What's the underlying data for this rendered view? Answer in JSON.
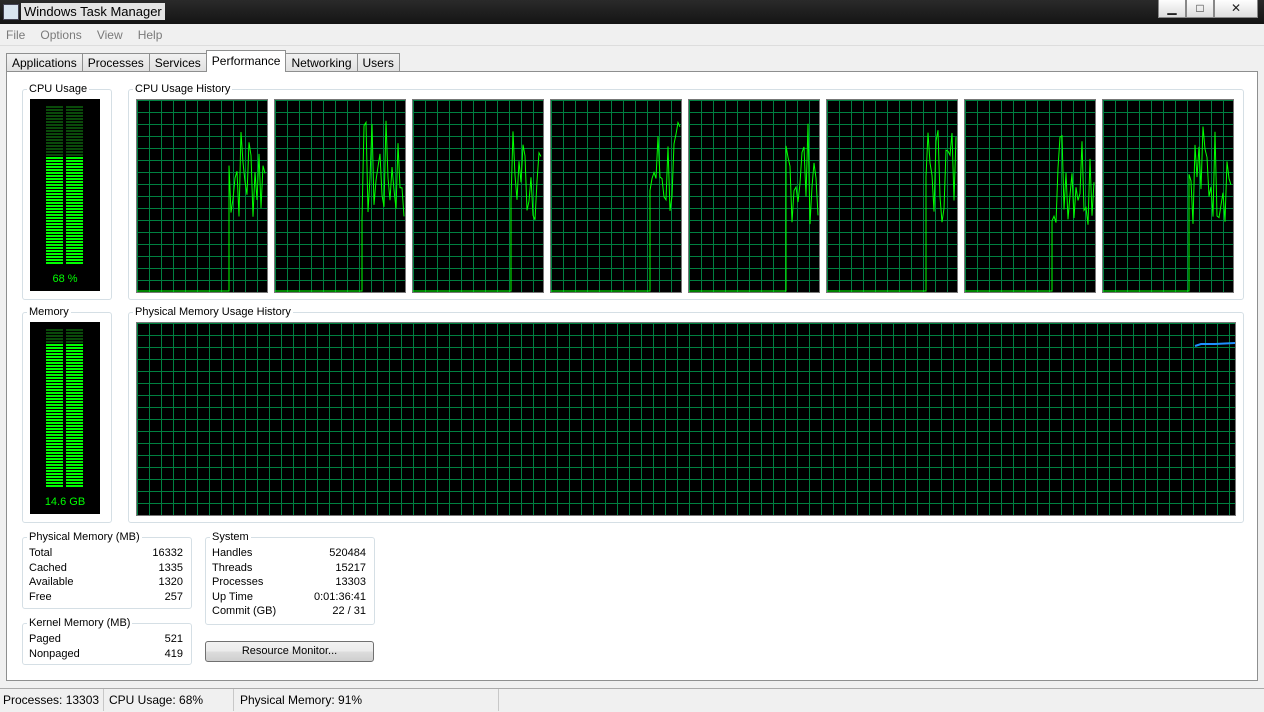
{
  "window": {
    "title": "Windows Task Manager",
    "minimize": "▁",
    "maximize": "□",
    "close": "✕"
  },
  "menu": [
    "File",
    "Options",
    "View",
    "Help"
  ],
  "tabs": [
    "Applications",
    "Processes",
    "Services",
    "Performance",
    "Networking",
    "Users"
  ],
  "active_tab": "Performance",
  "cpu_usage": {
    "label": "CPU Usage",
    "value_text": "68 %",
    "fraction": 0.68
  },
  "cpu_history": {
    "label": "CPU Usage History",
    "cores": 8
  },
  "memory": {
    "label": "Memory",
    "value_text": "14.6 GB",
    "fraction": 0.91
  },
  "memory_history": {
    "label": "Physical Memory Usage History"
  },
  "physical_memory": {
    "label": "Physical Memory (MB)",
    "rows": [
      {
        "name": "Total",
        "value": "16332"
      },
      {
        "name": "Cached",
        "value": "1335"
      },
      {
        "name": "Available",
        "value": "1320"
      },
      {
        "name": "Free",
        "value": "257"
      }
    ]
  },
  "kernel_memory": {
    "label": "Kernel Memory (MB)",
    "rows": [
      {
        "name": "Paged",
        "value": "521"
      },
      {
        "name": "Nonpaged",
        "value": "419"
      }
    ]
  },
  "system": {
    "label": "System",
    "rows": [
      {
        "name": "Handles",
        "value": "520484"
      },
      {
        "name": "Threads",
        "value": "15217"
      },
      {
        "name": "Processes",
        "value": "13303"
      },
      {
        "name": "Up Time",
        "value": "0:01:36:41"
      },
      {
        "name": "Commit (GB)",
        "value": "22 / 31"
      }
    ]
  },
  "resource_monitor_button": "Resource Monitor...",
  "status": {
    "processes": "Processes: 13303",
    "cpu": "CPU Usage: 68%",
    "memory": "Physical Memory: 91%"
  },
  "colors": {
    "graph_line": "#00ff00",
    "grid": "#008040",
    "memory_line": "#1e90ff",
    "graph_bg": "#000000"
  }
}
